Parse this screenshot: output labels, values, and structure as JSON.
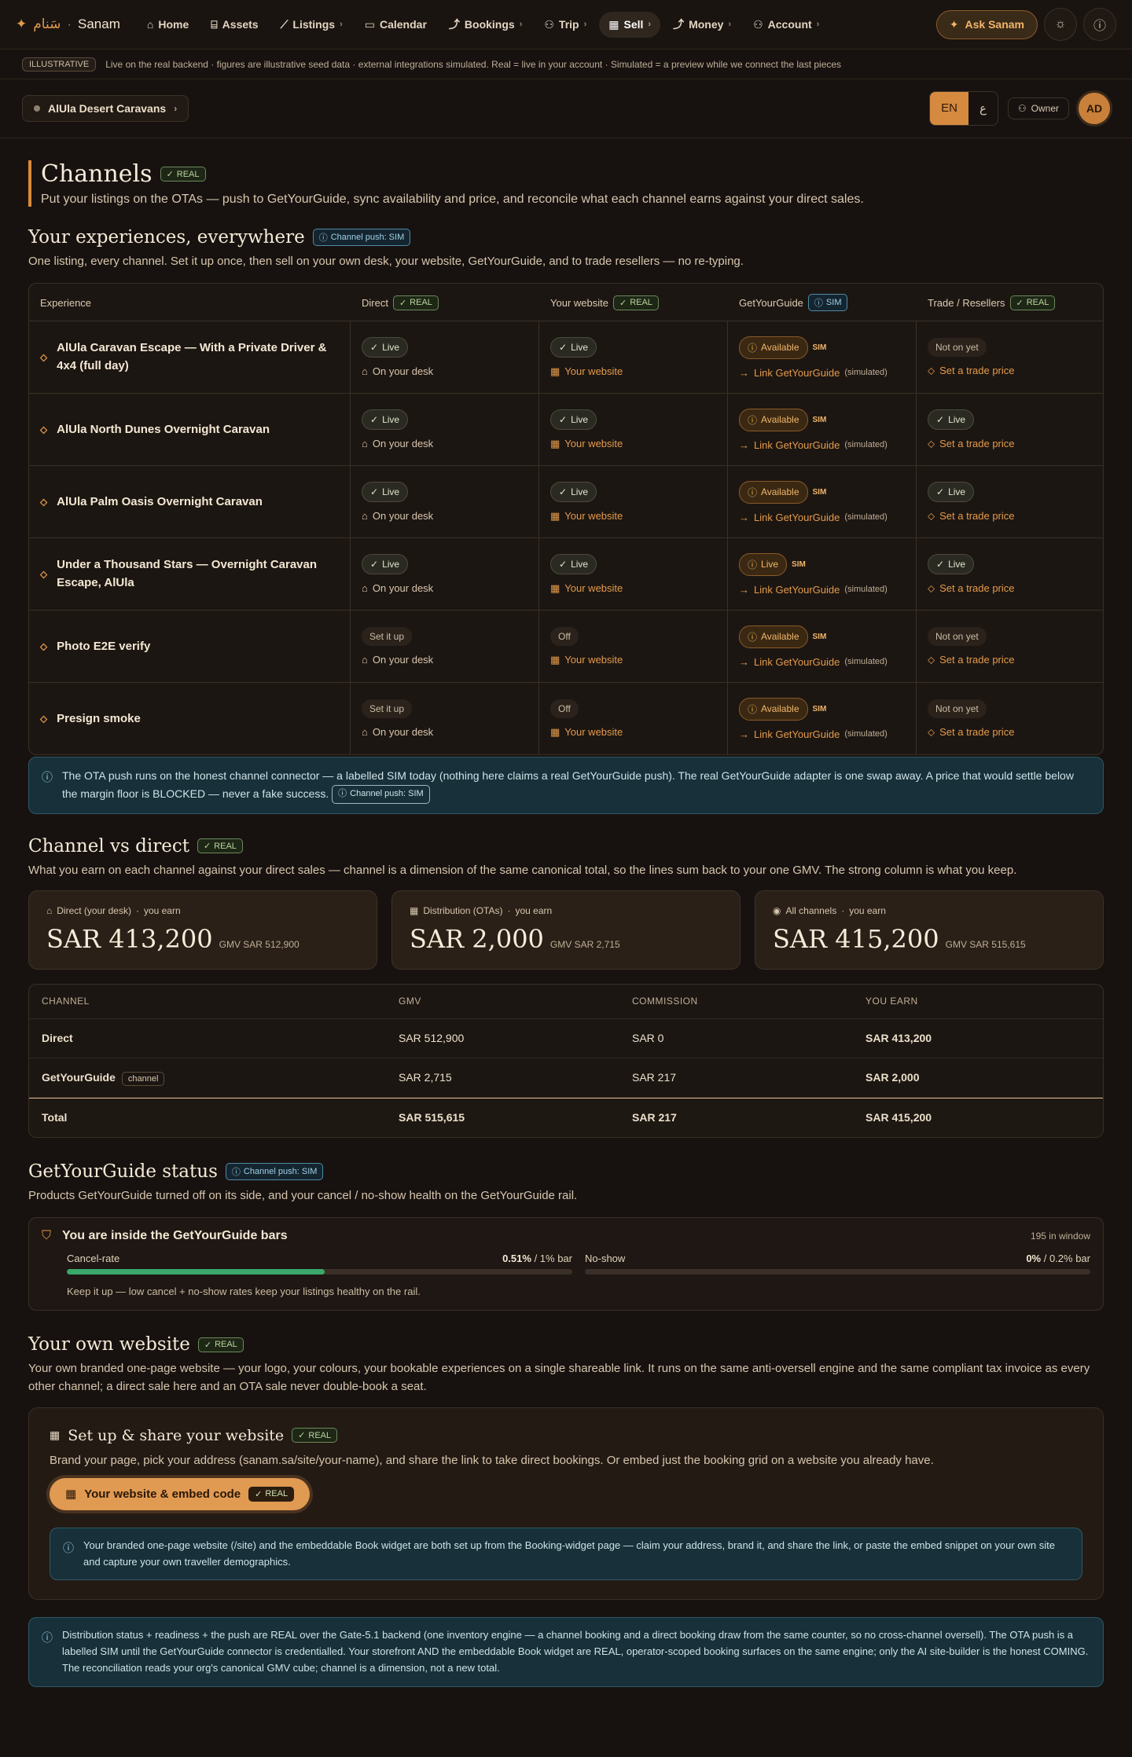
{
  "nav": {
    "brand_ar": "سَنام",
    "brand": "Sanam",
    "items": [
      {
        "label": "Home",
        "icon": "home-icon"
      },
      {
        "label": "Assets",
        "icon": "assets-icon"
      },
      {
        "label": "Listings",
        "icon": "listings-icon",
        "chev": true
      },
      {
        "label": "Calendar",
        "icon": "calendar-icon"
      },
      {
        "label": "Bookings",
        "icon": "bookings-icon",
        "chev": true
      },
      {
        "label": "Trip",
        "icon": "trip-icon",
        "chev": true
      },
      {
        "label": "Sell",
        "icon": "grid-icon",
        "chev": true,
        "active": true
      },
      {
        "label": "Money",
        "icon": "money-icon",
        "chev": true
      },
      {
        "label": "Account",
        "icon": "user-icon",
        "chev": true
      }
    ],
    "ask": "Ask Sanam"
  },
  "banner": {
    "tag": "ILLUSTRATIVE",
    "text": "Live on the real backend · figures are illustrative seed data · external integrations simulated.   Real = live in your account · Simulated = a preview while we connect the last pieces"
  },
  "subbar": {
    "workspace": "AlUla Desert Caravans",
    "lang_en": "EN",
    "lang_ar": "ع",
    "owner": "Owner",
    "avatar": "AD"
  },
  "page": {
    "title": "Channels",
    "title_tag": "REAL",
    "lead": "Put your listings on the OTAs — push to GetYourGuide, sync availability and price, and reconcile what each channel earns against your direct sales."
  },
  "everywhere": {
    "title": "Your experiences, everywhere",
    "tag": "Channel push: SIM",
    "desc": "One listing, every channel. Set it up once, then sell on your own desk, your website, GetYourGuide, and to trade resellers — no re-typing.",
    "headers": [
      {
        "label": "Experience"
      },
      {
        "label": "Direct",
        "tag": "REAL",
        "kind": "real"
      },
      {
        "label": "Your website",
        "tag": "REAL",
        "kind": "real"
      },
      {
        "label": "GetYourGuide",
        "tag": "SIM",
        "kind": "sim"
      },
      {
        "label": "Trade / Resellers",
        "tag": "REAL",
        "kind": "real"
      }
    ],
    "common": {
      "on_desk": "On your desk",
      "your_website": "Your website",
      "link_gyg": "Link GetYourGuide",
      "simulated": "(simulated)",
      "trade": "Set a trade price",
      "sim": "SIM"
    },
    "rows": [
      {
        "name": "AlUla Caravan Escape — With a Private Driver & 4x4 (full day)",
        "direct": "Live",
        "web": "Live",
        "gyg": "Available",
        "trade": "Not on yet"
      },
      {
        "name": "AlUla North Dunes Overnight Caravan",
        "direct": "Live",
        "web": "Live",
        "gyg": "Available",
        "trade": "Live"
      },
      {
        "name": "AlUla Palm Oasis Overnight Caravan",
        "direct": "Live",
        "web": "Live",
        "gyg": "Available",
        "trade": "Live"
      },
      {
        "name": "Under a Thousand Stars — Overnight Caravan Escape, AlUla",
        "direct": "Live",
        "web": "Live",
        "gyg": "Live",
        "trade": "Live"
      },
      {
        "name": "Photo E2E verify",
        "direct": "Set it up",
        "web": "Off",
        "gyg": "Available",
        "trade": "Not on yet"
      },
      {
        "name": "Presign smoke",
        "direct": "Set it up",
        "web": "Off",
        "gyg": "Available",
        "trade": "Not on yet"
      }
    ],
    "note": "The OTA push runs on the honest channel connector — a labelled SIM today (nothing here claims a real GetYourGuide push). The real GetYourGuide adapter is one swap away. A price that would settle below the margin floor is BLOCKED — never a fake success.",
    "note_tag": "Channel push: SIM"
  },
  "cvd": {
    "title": "Channel vs direct",
    "tag": "REAL",
    "desc": "What you earn on each channel against your direct sales — channel is a dimension of the same canonical total, so the lines sum back to your one GMV. The strong column is what you keep.",
    "cards": [
      {
        "label": "Direct (your desk)",
        "earn": "you earn",
        "value": "SAR 413,200",
        "gmv": "GMV SAR 512,900",
        "icon": "home-icon"
      },
      {
        "label": "Distribution (OTAs)",
        "earn": "you earn",
        "value": "SAR 2,000",
        "gmv": "GMV SAR 2,715",
        "icon": "grid-icon"
      },
      {
        "label": "All channels",
        "earn": "you earn",
        "value": "SAR 415,200",
        "gmv": "GMV SAR 515,615",
        "icon": "coin-icon"
      }
    ],
    "table": {
      "headers": [
        "Channel",
        "GMV",
        "Commission",
        "You earn"
      ],
      "rows": [
        [
          "Direct",
          "SAR 512,900",
          "SAR 0",
          "SAR 413,200"
        ],
        [
          "GetYourGuide",
          "SAR 2,715",
          "SAR 217",
          "SAR 2,000"
        ]
      ],
      "channel_tag": "channel",
      "total": [
        "Total",
        "SAR 515,615",
        "SAR 217",
        "SAR 415,200"
      ]
    }
  },
  "gygstatus": {
    "title": "GetYourGuide status",
    "tag": "Channel push: SIM",
    "desc": "Products GetYourGuide turned off on its side, and your cancel / no-show health on the GetYourGuide rail.",
    "box_title": "You are inside the GetYourGuide bars",
    "window": "195 in window",
    "cancel": {
      "label": "Cancel-rate",
      "value": "0.51%",
      "bar": "/ 1% bar",
      "fraction": 0.51
    },
    "noshow": {
      "label": "No-show",
      "value": "0%",
      "bar": "/ 0.2% bar",
      "fraction": 0
    },
    "keep": "Keep it up — low cancel + no-show rates keep your listings healthy on the rail."
  },
  "website": {
    "title": "Your own website",
    "tag": "REAL",
    "desc": "Your own branded one-page website — your logo, your colours, your bookable experiences on a single shareable link. It runs on the same anti-oversell engine and the same compliant tax invoice as every other channel; a direct sale here and an OTA sale never double-book a seat.",
    "box_title": "Set up & share your website",
    "box_tag": "REAL",
    "box_desc": "Brand your page, pick your address (sanam.sa/site/your-name), and share the link to take direct bookings. Or embed just the booking grid on a website you already have.",
    "button": "Your website & embed code",
    "button_tag": "REAL",
    "note": "Your branded one-page website (/site) and the embeddable Book widget are both set up from the Booking-widget page — claim your address, brand it, and share the link, or paste the embed snippet on your own site and capture your own traveller demographics."
  },
  "footer_note": "Distribution status + readiness + the push are REAL over the Gate-5.1 backend (one inventory engine — a channel booking and a direct booking draw from the same counter, so no cross-channel oversell). The OTA push is a labelled SIM until the GetYourGuide connector is credentialled. Your storefront AND the embeddable Book widget are REAL, operator-scoped booking surfaces on the same engine; only the AI site-builder is the honest COMING. The reconciliation reads your org's canonical GMV cube; channel is a dimension, not a new total."
}
